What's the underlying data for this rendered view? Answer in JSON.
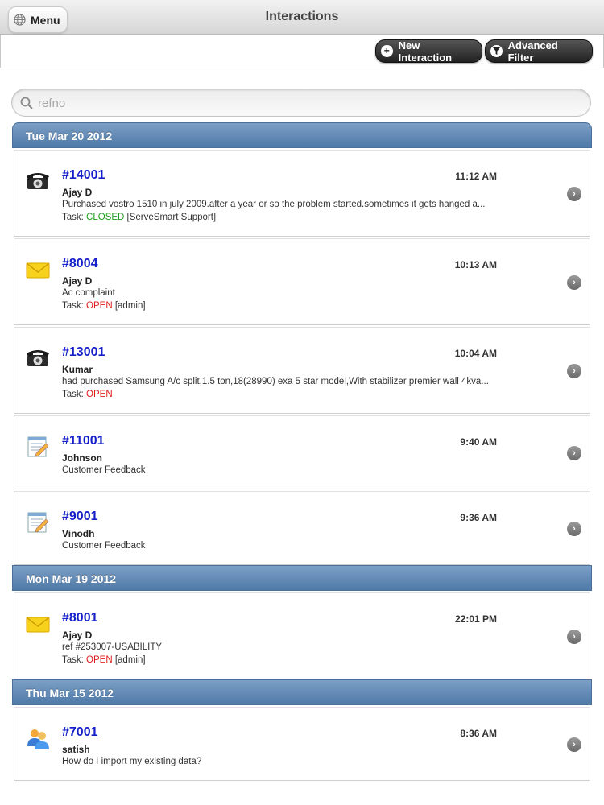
{
  "header": {
    "title": "Interactions",
    "menu_label": "Menu"
  },
  "toolbar": {
    "new_label": "New Interaction",
    "filter_label": "Advanced Filter"
  },
  "search": {
    "placeholder": "refno"
  },
  "status_colors": {
    "CLOSED": "#1f9e1f",
    "OPEN": "#e01c1c"
  },
  "sections": [
    {
      "date": "Tue Mar 20 2012",
      "items": [
        {
          "type": "phone",
          "ref": "#14001",
          "time": "11:12 AM",
          "name": "Ajay D",
          "desc": "Purchased vostro 1510 in july 2009.after a year or so the problem started.sometimes it gets hanged a...",
          "task_prefix": "Task:",
          "status": "CLOSED",
          "assignee": "[ServeSmart Support]"
        },
        {
          "type": "email",
          "ref": "#8004",
          "time": "10:13 AM",
          "name": "Ajay D",
          "desc": "Ac complaint",
          "task_prefix": "Task:",
          "status": "OPEN",
          "assignee": "[admin]"
        },
        {
          "type": "phone",
          "ref": "#13001",
          "time": "10:04 AM",
          "name": "Kumar",
          "desc": "had purchased Samsung A/c split,1.5 ton,18(28990) exa 5 star model,With stabilizer premier wall 4kva...",
          "task_prefix": "Task:",
          "status": "OPEN",
          "assignee": ""
        },
        {
          "type": "feedback",
          "ref": "#11001",
          "time": "9:40 AM",
          "name": "Johnson",
          "desc": "Customer Feedback",
          "task_prefix": "",
          "status": "",
          "assignee": ""
        },
        {
          "type": "feedback",
          "ref": "#9001",
          "time": "9:36 AM",
          "name": "Vinodh",
          "desc": "Customer Feedback",
          "task_prefix": "",
          "status": "",
          "assignee": ""
        }
      ]
    },
    {
      "date": "Mon Mar 19 2012",
      "items": [
        {
          "type": "email",
          "ref": "#8001",
          "time": "22:01 PM",
          "name": "Ajay D",
          "desc": "ref #253007-USABILITY",
          "task_prefix": "Task:",
          "status": "OPEN",
          "assignee": "[admin]"
        }
      ]
    },
    {
      "date": "Thu Mar 15 2012",
      "items": [
        {
          "type": "chat",
          "ref": "#7001",
          "time": "8:36 AM",
          "name": "satish",
          "desc": "How do I import my existing data?",
          "task_prefix": "",
          "status": "",
          "assignee": ""
        }
      ]
    }
  ]
}
